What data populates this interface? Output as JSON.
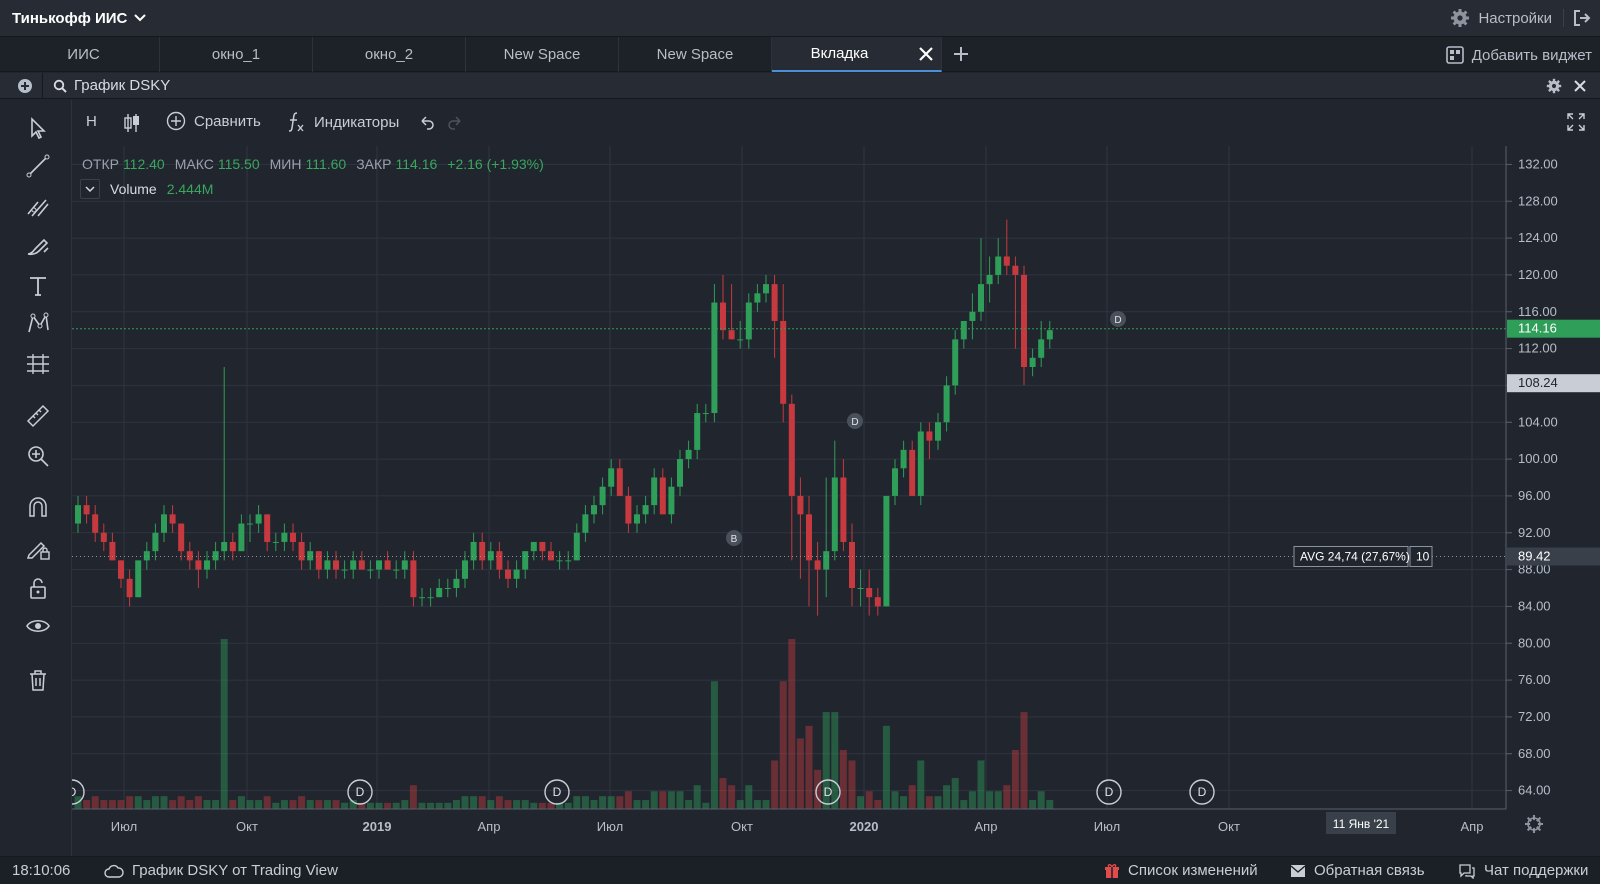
{
  "topbar": {
    "account": "Тинькофф ИИС",
    "settings_label": "Настройки"
  },
  "tabs": [
    {
      "label": "ИИС"
    },
    {
      "label": "окно_1"
    },
    {
      "label": "окно_2"
    },
    {
      "label": "New Space"
    },
    {
      "label": "New Space"
    },
    {
      "label": "Вкладка",
      "active": true
    }
  ],
  "add_widget_label": "Добавить виджет",
  "widget": {
    "title": "График DSKY"
  },
  "toolbar": {
    "interval": "Н",
    "compare": "Сравнить",
    "indicators": "Индикаторы"
  },
  "legend": {
    "open_label": "ОТКР",
    "open": "112.40",
    "high_label": "МАКС",
    "high": "115.50",
    "low_label": "МИН",
    "low": "111.60",
    "close_label": "ЗАКР",
    "close": "114.16",
    "change": "+2.16 (+1.93%)"
  },
  "volume": {
    "label": "Volume",
    "value": "2.444M"
  },
  "chart_data": {
    "type": "candlestick",
    "symbol": "DSKY",
    "ylim": [
      62,
      134
    ],
    "y_ticks": [
      "132.00",
      "128.00",
      "124.00",
      "120.00",
      "116.00",
      "112.00",
      "108.00",
      "104.00",
      "100.00",
      "96.00",
      "92.00",
      "88.00",
      "84.00",
      "80.00",
      "76.00",
      "72.00",
      "68.00",
      "64.00"
    ],
    "x_ticks": [
      "Июл",
      "Окт",
      "2019",
      "Апр",
      "Июл",
      "Окт",
      "2020",
      "Апр",
      "Июл",
      "Окт",
      "Апр"
    ],
    "crosshair_x_label": "11 Янв '21",
    "price_labels": {
      "last": "114.16",
      "mark_1": "108.24",
      "avg_line": "89.42"
    },
    "avg_label": "AVG 24,74 (27,67%)",
    "avg_qty": "10",
    "event_markers": [
      "D",
      "D",
      "D",
      "B",
      "D",
      "D",
      "D",
      "D"
    ],
    "series": [
      {
        "name": "Volume",
        "note": ""
      }
    ],
    "candles_approx": [
      [
        93,
        96,
        92,
        95
      ],
      [
        95,
        96,
        93,
        94
      ],
      [
        94,
        95,
        91,
        92
      ],
      [
        92,
        93,
        90,
        91
      ],
      [
        91,
        92,
        89,
        89
      ],
      [
        89,
        89,
        86,
        87
      ],
      [
        87,
        88,
        84,
        85
      ],
      [
        85,
        89,
        85,
        89
      ],
      [
        89,
        91,
        88,
        90
      ],
      [
        90,
        93,
        89,
        92
      ],
      [
        92,
        95,
        91,
        94
      ],
      [
        94,
        95,
        92,
        93
      ],
      [
        93,
        93,
        89,
        90
      ],
      [
        90,
        91,
        88,
        89
      ],
      [
        89,
        90,
        86,
        88
      ],
      [
        88,
        90,
        87,
        89
      ],
      [
        89,
        91,
        88,
        90
      ],
      [
        90,
        110,
        89,
        91
      ],
      [
        91,
        92,
        89,
        90
      ],
      [
        90,
        94,
        90,
        93
      ],
      [
        93,
        94,
        91,
        93
      ],
      [
        93,
        95,
        92,
        94
      ],
      [
        94,
        94,
        90,
        91
      ],
      [
        91,
        92,
        90,
        91
      ],
      [
        91,
        93,
        90,
        92
      ],
      [
        92,
        93,
        90,
        91
      ],
      [
        91,
        92,
        88,
        89
      ],
      [
        89,
        91,
        88,
        90
      ],
      [
        90,
        90,
        87,
        88
      ],
      [
        88,
        90,
        87,
        89
      ],
      [
        89,
        90,
        87,
        88
      ],
      [
        88,
        89,
        87,
        88
      ],
      [
        88,
        90,
        87,
        89
      ],
      [
        89,
        90,
        88,
        88
      ],
      [
        88,
        89,
        87,
        88
      ],
      [
        88,
        89,
        87,
        89
      ],
      [
        89,
        90,
        88,
        88
      ],
      [
        88,
        89,
        87,
        88
      ],
      [
        88,
        90,
        87,
        89
      ],
      [
        89,
        90,
        84,
        85
      ],
      [
        85,
        86,
        84,
        85
      ],
      [
        85,
        86,
        84,
        85
      ],
      [
        85,
        87,
        85,
        86
      ],
      [
        86,
        87,
        85,
        86
      ],
      [
        86,
        88,
        85,
        87
      ],
      [
        87,
        90,
        86,
        89
      ],
      [
        89,
        92,
        88,
        91
      ],
      [
        91,
        92,
        88,
        89
      ],
      [
        89,
        91,
        88,
        90
      ],
      [
        90,
        91,
        87,
        88
      ],
      [
        88,
        89,
        86,
        87
      ],
      [
        87,
        89,
        86,
        88
      ],
      [
        88,
        90,
        87,
        90
      ],
      [
        90,
        91,
        89,
        91
      ],
      [
        91,
        91,
        89,
        90
      ],
      [
        90,
        91,
        89,
        89
      ],
      [
        89,
        90,
        88,
        89
      ],
      [
        89,
        90,
        88,
        89
      ],
      [
        89,
        93,
        89,
        92
      ],
      [
        92,
        95,
        91,
        94
      ],
      [
        94,
        96,
        93,
        95
      ],
      [
        95,
        98,
        94,
        97
      ],
      [
        97,
        100,
        96,
        99
      ],
      [
        99,
        100,
        96,
        96
      ],
      [
        96,
        97,
        92,
        93
      ],
      [
        93,
        95,
        92,
        94
      ],
      [
        94,
        96,
        93,
        95
      ],
      [
        95,
        99,
        94,
        98
      ],
      [
        98,
        99,
        94,
        94
      ],
      [
        94,
        98,
        93,
        97
      ],
      [
        97,
        101,
        96,
        100
      ],
      [
        100,
        102,
        99,
        101
      ],
      [
        101,
        106,
        100,
        105
      ],
      [
        105,
        106,
        104,
        105
      ],
      [
        105,
        119,
        104,
        117
      ],
      [
        117,
        120,
        113,
        114
      ],
      [
        114,
        119,
        113,
        113
      ],
      [
        113,
        115,
        112,
        113
      ],
      [
        113,
        118,
        112,
        117
      ],
      [
        117,
        119,
        116,
        118
      ],
      [
        118,
        120,
        117,
        119
      ],
      [
        119,
        120,
        111,
        115
      ],
      [
        115,
        119,
        104,
        106
      ],
      [
        106,
        107,
        89,
        96
      ],
      [
        96,
        98,
        87,
        94
      ],
      [
        94,
        96,
        84,
        89
      ],
      [
        89,
        91,
        83,
        88
      ],
      [
        88,
        98,
        85,
        90
      ],
      [
        90,
        102,
        89,
        98
      ],
      [
        98,
        100,
        90,
        91
      ],
      [
        91,
        93,
        84,
        86
      ],
      [
        86,
        88,
        84,
        86
      ],
      [
        86,
        88,
        83,
        85
      ],
      [
        85,
        86,
        83,
        84
      ],
      [
        84,
        96,
        84,
        96
      ],
      [
        96,
        100,
        95,
        99
      ],
      [
        99,
        102,
        98,
        101
      ],
      [
        101,
        102,
        96,
        96
      ],
      [
        96,
        104,
        95,
        103
      ],
      [
        103,
        104,
        100,
        102
      ],
      [
        102,
        105,
        101,
        104
      ],
      [
        104,
        109,
        103,
        108
      ],
      [
        108,
        114,
        107,
        113
      ],
      [
        113,
        115,
        112,
        115
      ],
      [
        115,
        118,
        113,
        116
      ],
      [
        116,
        124,
        115,
        119
      ],
      [
        119,
        122,
        117,
        120
      ],
      [
        120,
        124,
        119,
        122
      ],
      [
        122,
        126,
        120,
        121
      ],
      [
        121,
        122,
        112,
        120
      ],
      [
        120,
        121,
        108,
        110
      ],
      [
        110,
        112,
        109,
        111
      ],
      [
        111,
        115,
        110,
        113
      ],
      [
        113,
        115,
        112,
        114
      ]
    ]
  },
  "status": {
    "clock": "18:10:06",
    "source": "График DSKY от Trading View",
    "changelog": "Список изменений",
    "feedback": "Обратная связь",
    "support": "Чат поддержки"
  }
}
